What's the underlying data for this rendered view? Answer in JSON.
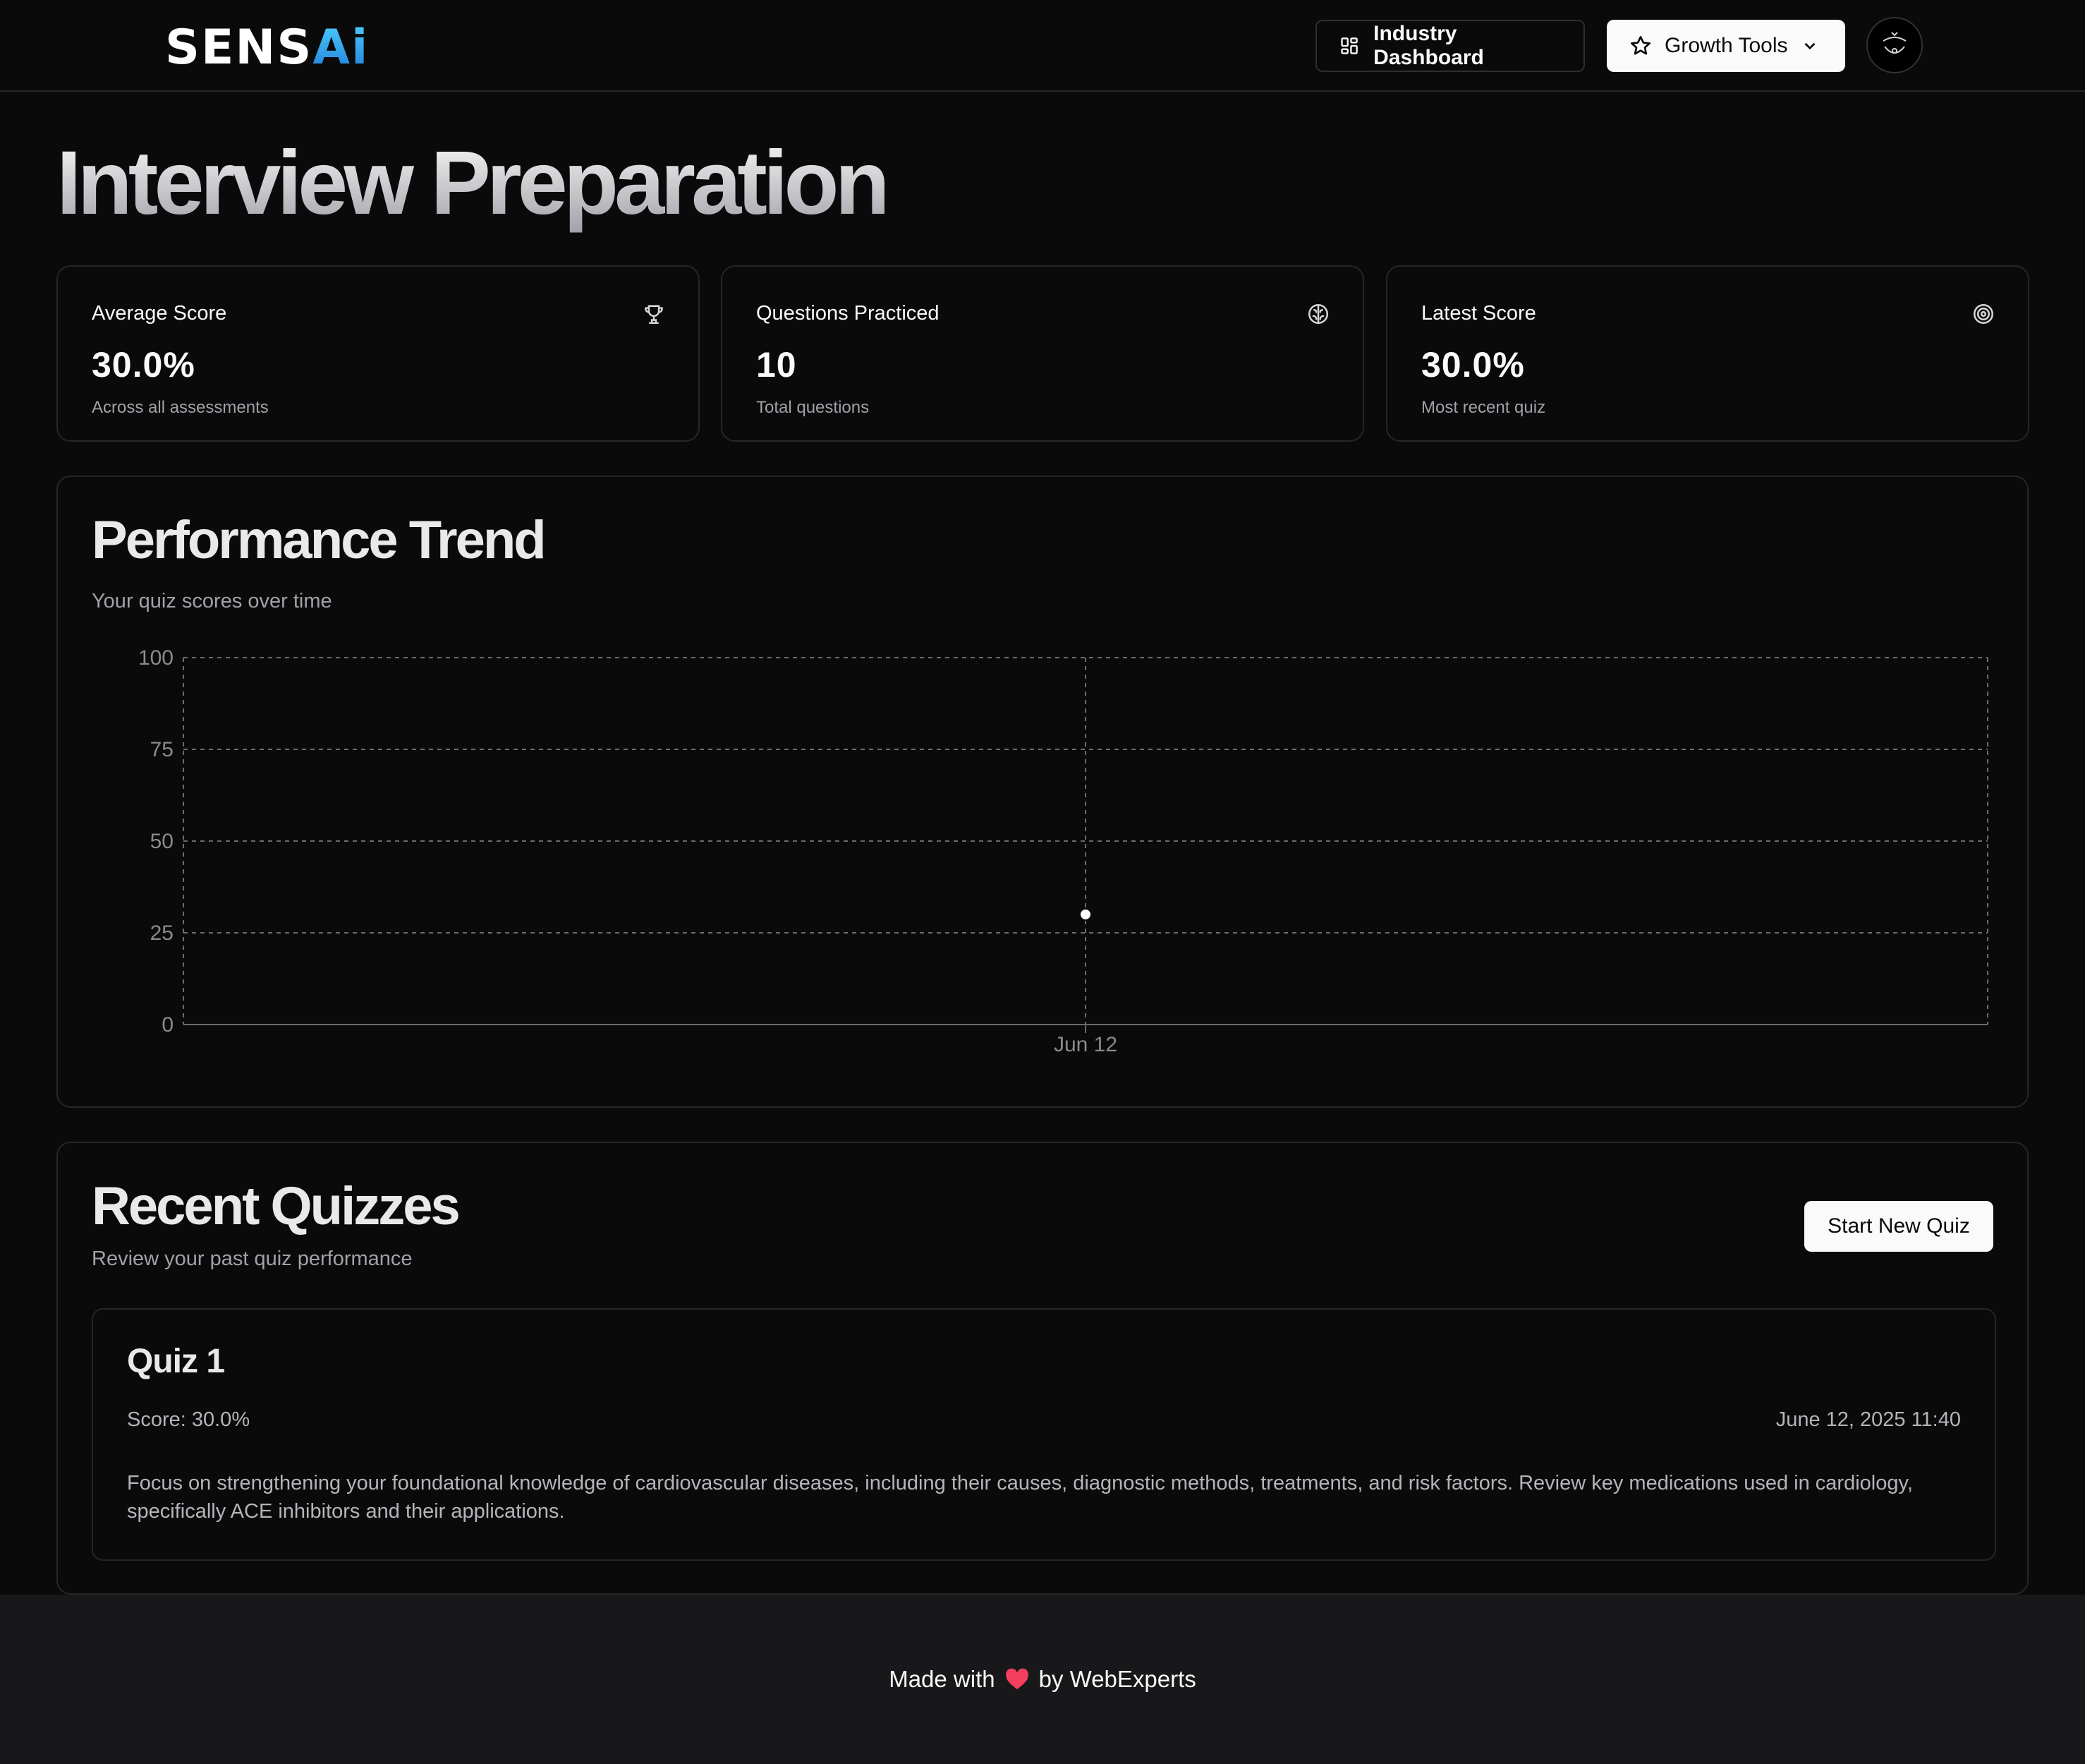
{
  "header": {
    "logo_main": "SENS",
    "logo_accent": "Ai",
    "industry_button": "Industry Dashboard",
    "growth_button": "Growth Tools"
  },
  "page": {
    "title": "Interview Preparation"
  },
  "stats": [
    {
      "label": "Average Score",
      "value": "30.0%",
      "sub": "Across all assessments",
      "icon": "trophy-icon"
    },
    {
      "label": "Questions Practiced",
      "value": "10",
      "sub": "Total questions",
      "icon": "brain-icon"
    },
    {
      "label": "Latest Score",
      "value": "30.0%",
      "sub": "Most recent quiz",
      "icon": "target-icon"
    }
  ],
  "performance": {
    "title": "Performance Trend",
    "subtitle": "Your quiz scores over time"
  },
  "chart_data": {
    "type": "line",
    "categories": [
      "Jun 12"
    ],
    "values": [
      30
    ],
    "ylim": [
      0,
      100
    ],
    "yticks": [
      "0",
      "25",
      "50",
      "75",
      "100"
    ],
    "grid": true,
    "point_color": "#ffffff"
  },
  "quizzes": {
    "title": "Recent Quizzes",
    "subtitle": "Review your past quiz performance",
    "new_quiz_button": "Start New Quiz",
    "items": [
      {
        "title": "Quiz 1",
        "score": "Score: 30.0%",
        "date": "June 12, 2025 11:40",
        "feedback": "Focus on strengthening your foundational knowledge of cardiovascular diseases, including their causes, diagnostic methods, treatments, and risk factors. Review key medications used in cardiology, specifically ACE inhibitors and their applications."
      }
    ]
  },
  "footer": {
    "made_with": "Made with",
    "by": "by WebExperts"
  },
  "colors": {
    "background": "#0a0a0a",
    "border": "#262626",
    "muted_text": "#a1a1aa",
    "footer_bg": "#18181b",
    "logo_accent": "#1e7bd8",
    "heart": "#f43f5e"
  }
}
